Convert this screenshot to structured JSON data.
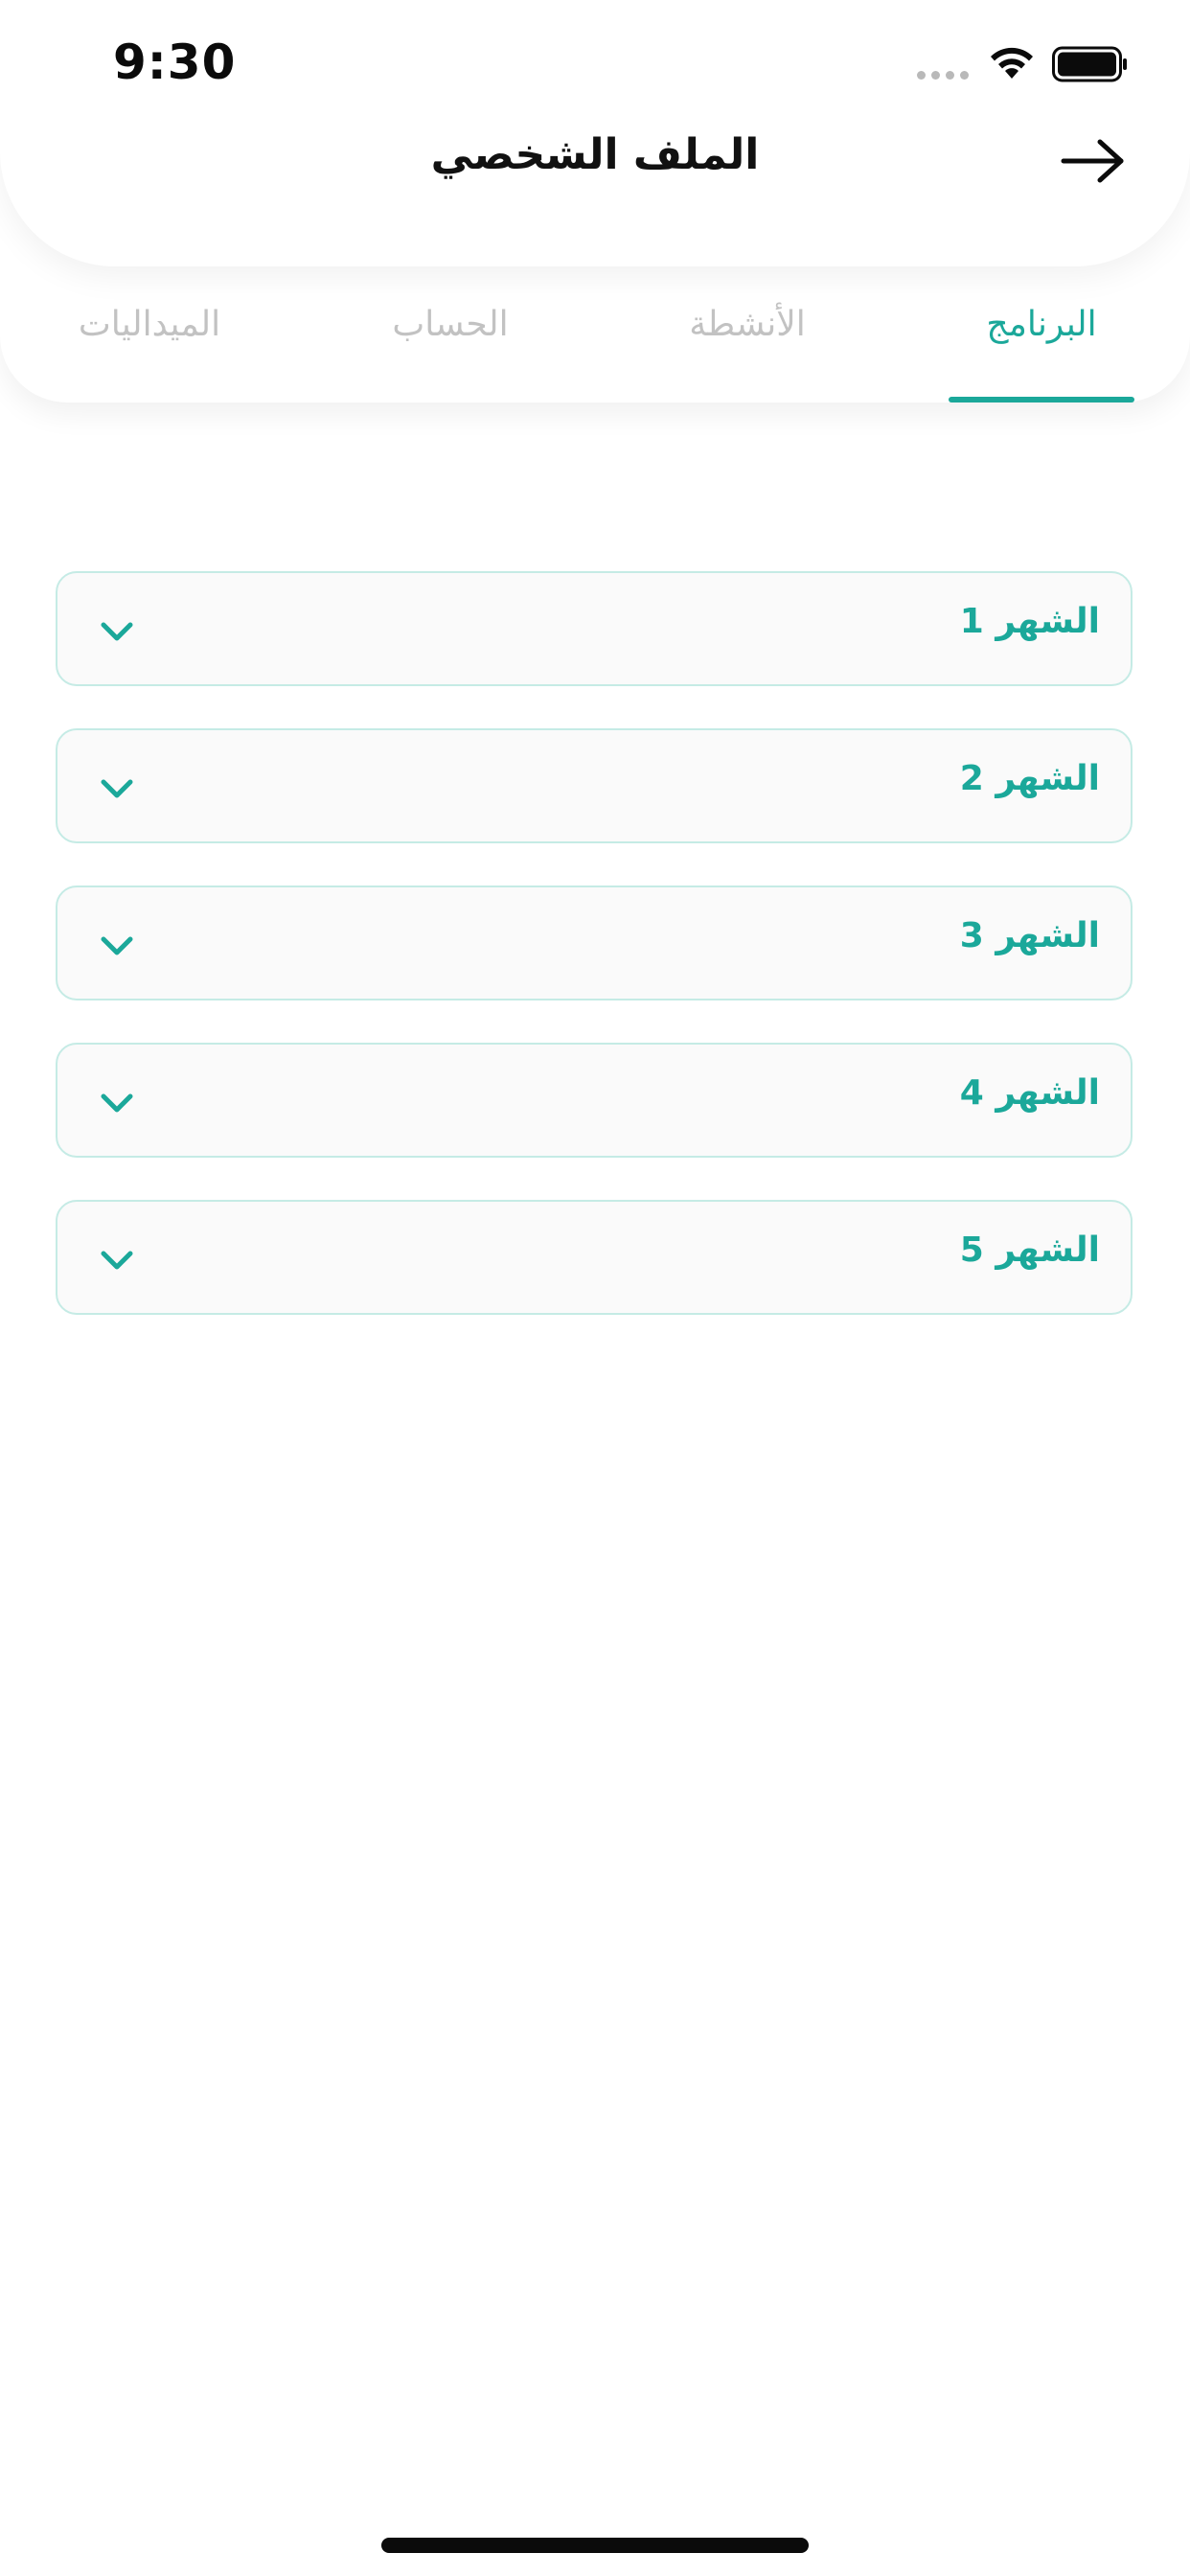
{
  "status_bar": {
    "time": "9:30"
  },
  "header": {
    "title": "الملف الشخصي",
    "back_icon": "arrow-right-icon"
  },
  "tabs": [
    {
      "label": "البرنامج",
      "active": true
    },
    {
      "label": "الأنشطة",
      "active": false
    },
    {
      "label": "الحساب",
      "active": false
    },
    {
      "label": "الميداليات",
      "active": false
    }
  ],
  "months": [
    {
      "label": "الشهر 1"
    },
    {
      "label": "الشهر 2"
    },
    {
      "label": "الشهر 3"
    },
    {
      "label": "الشهر 4"
    },
    {
      "label": "الشهر 5"
    }
  ],
  "colors": {
    "accent": "#1ba89a",
    "row_border": "#c5ebe5",
    "row_background": "#fafafa",
    "inactive_tab": "#c2c2c2"
  },
  "icons": {
    "chevron": "chevron-down-icon",
    "wifi": "wifi-icon",
    "battery": "battery-icon"
  }
}
